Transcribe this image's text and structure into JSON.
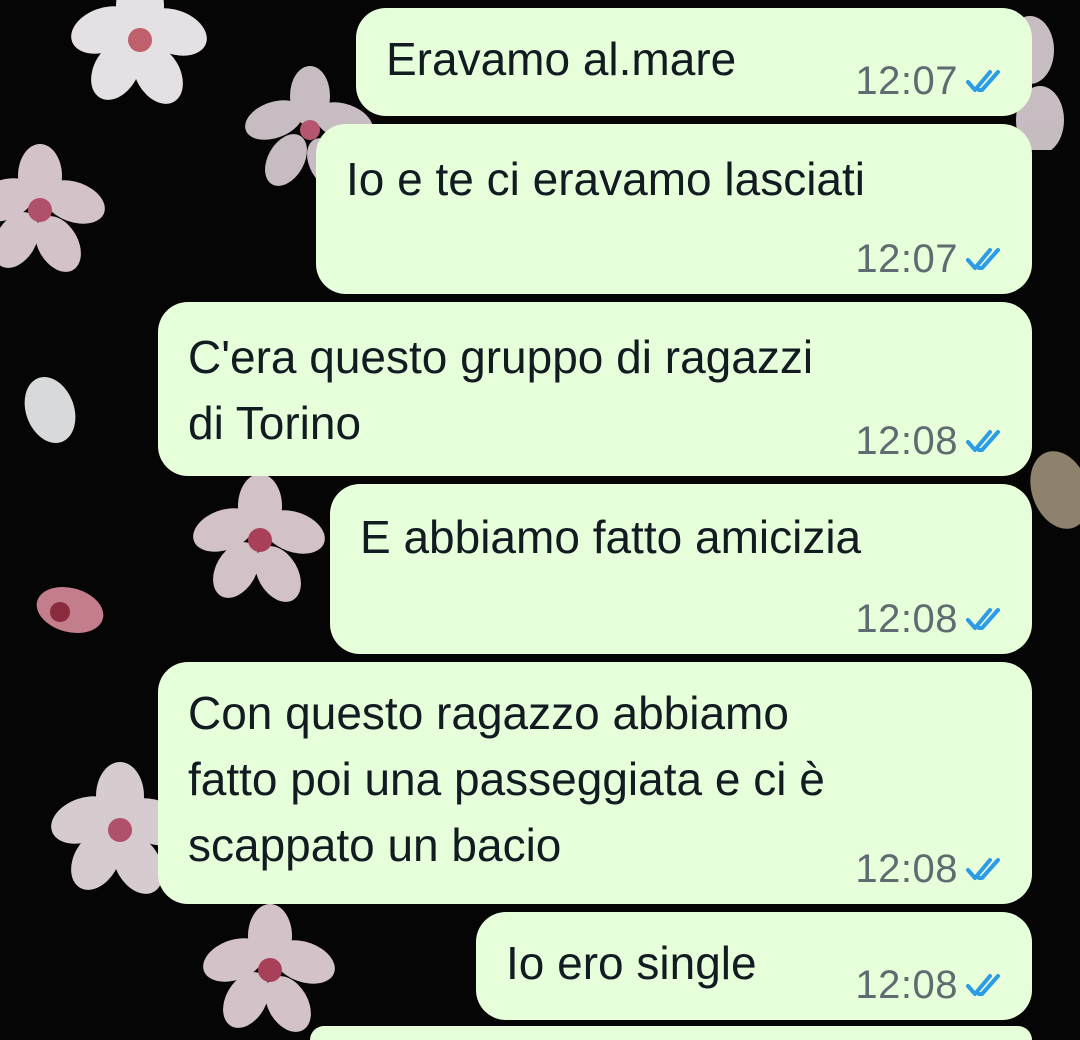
{
  "messages": [
    {
      "text": "Eravamo al.mare",
      "time": "12:07",
      "status": "read"
    },
    {
      "text": "Io e te ci eravamo lasciati",
      "time": "12:07",
      "status": "read"
    },
    {
      "text": "C'era questo gruppo di ragazzi\ndi Torino",
      "time": "12:08",
      "status": "read"
    },
    {
      "text": "E abbiamo fatto amicizia",
      "time": "12:08",
      "status": "read"
    },
    {
      "text": "Con questo ragazzo abbiamo\nfatto poi una passeggiata e ci è\nscappato un bacio",
      "time": "12:08",
      "status": "read"
    },
    {
      "text": "Io ero single",
      "time": "12:08",
      "status": "read"
    }
  ],
  "colors": {
    "outgoing_bubble": "#e6ffda",
    "read_ticks": "#2d9be6",
    "timestamp": "#5f6b70",
    "background": "#050505"
  },
  "icons": {
    "read_status": "double-check-icon",
    "wallpaper": "cherry-blossom-flower-icon"
  }
}
